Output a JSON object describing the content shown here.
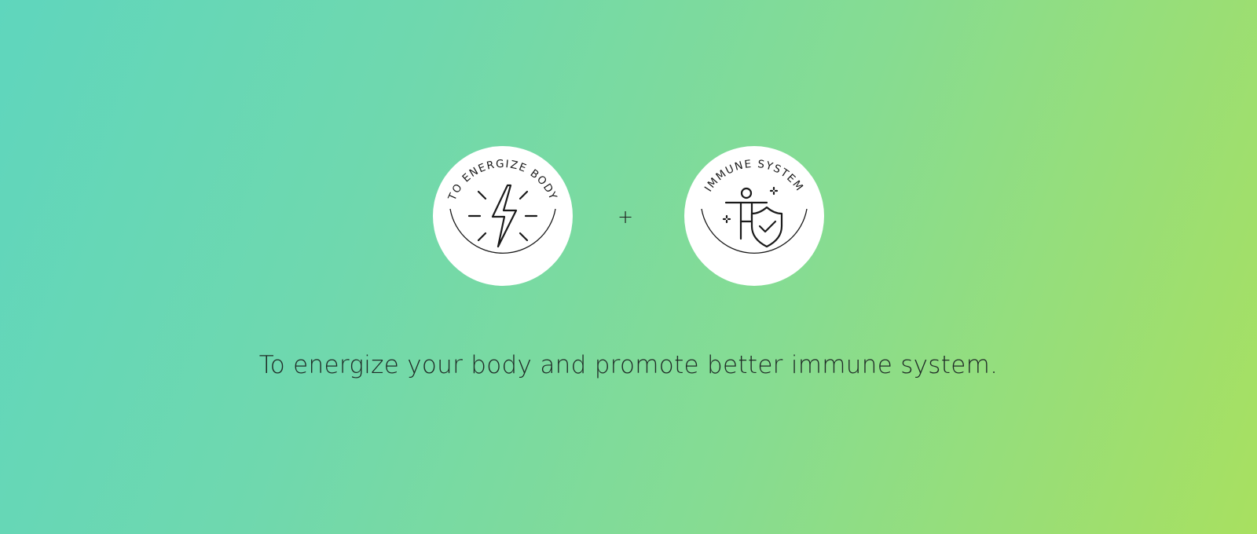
{
  "badges": [
    {
      "label": "TO ENERGIZE BODY",
      "icon": "lightning-bolt-icon"
    },
    {
      "label": "IMMUNE SYSTEM",
      "icon": "body-shield-check-icon"
    }
  ],
  "connector": "+",
  "caption": "To energize your body and promote better immune system.",
  "colors": {
    "gradient_start": "#5fd6bd",
    "gradient_end": "#a8e060",
    "badge_fill": "#ffffff",
    "ink": "#1a1a1a"
  }
}
